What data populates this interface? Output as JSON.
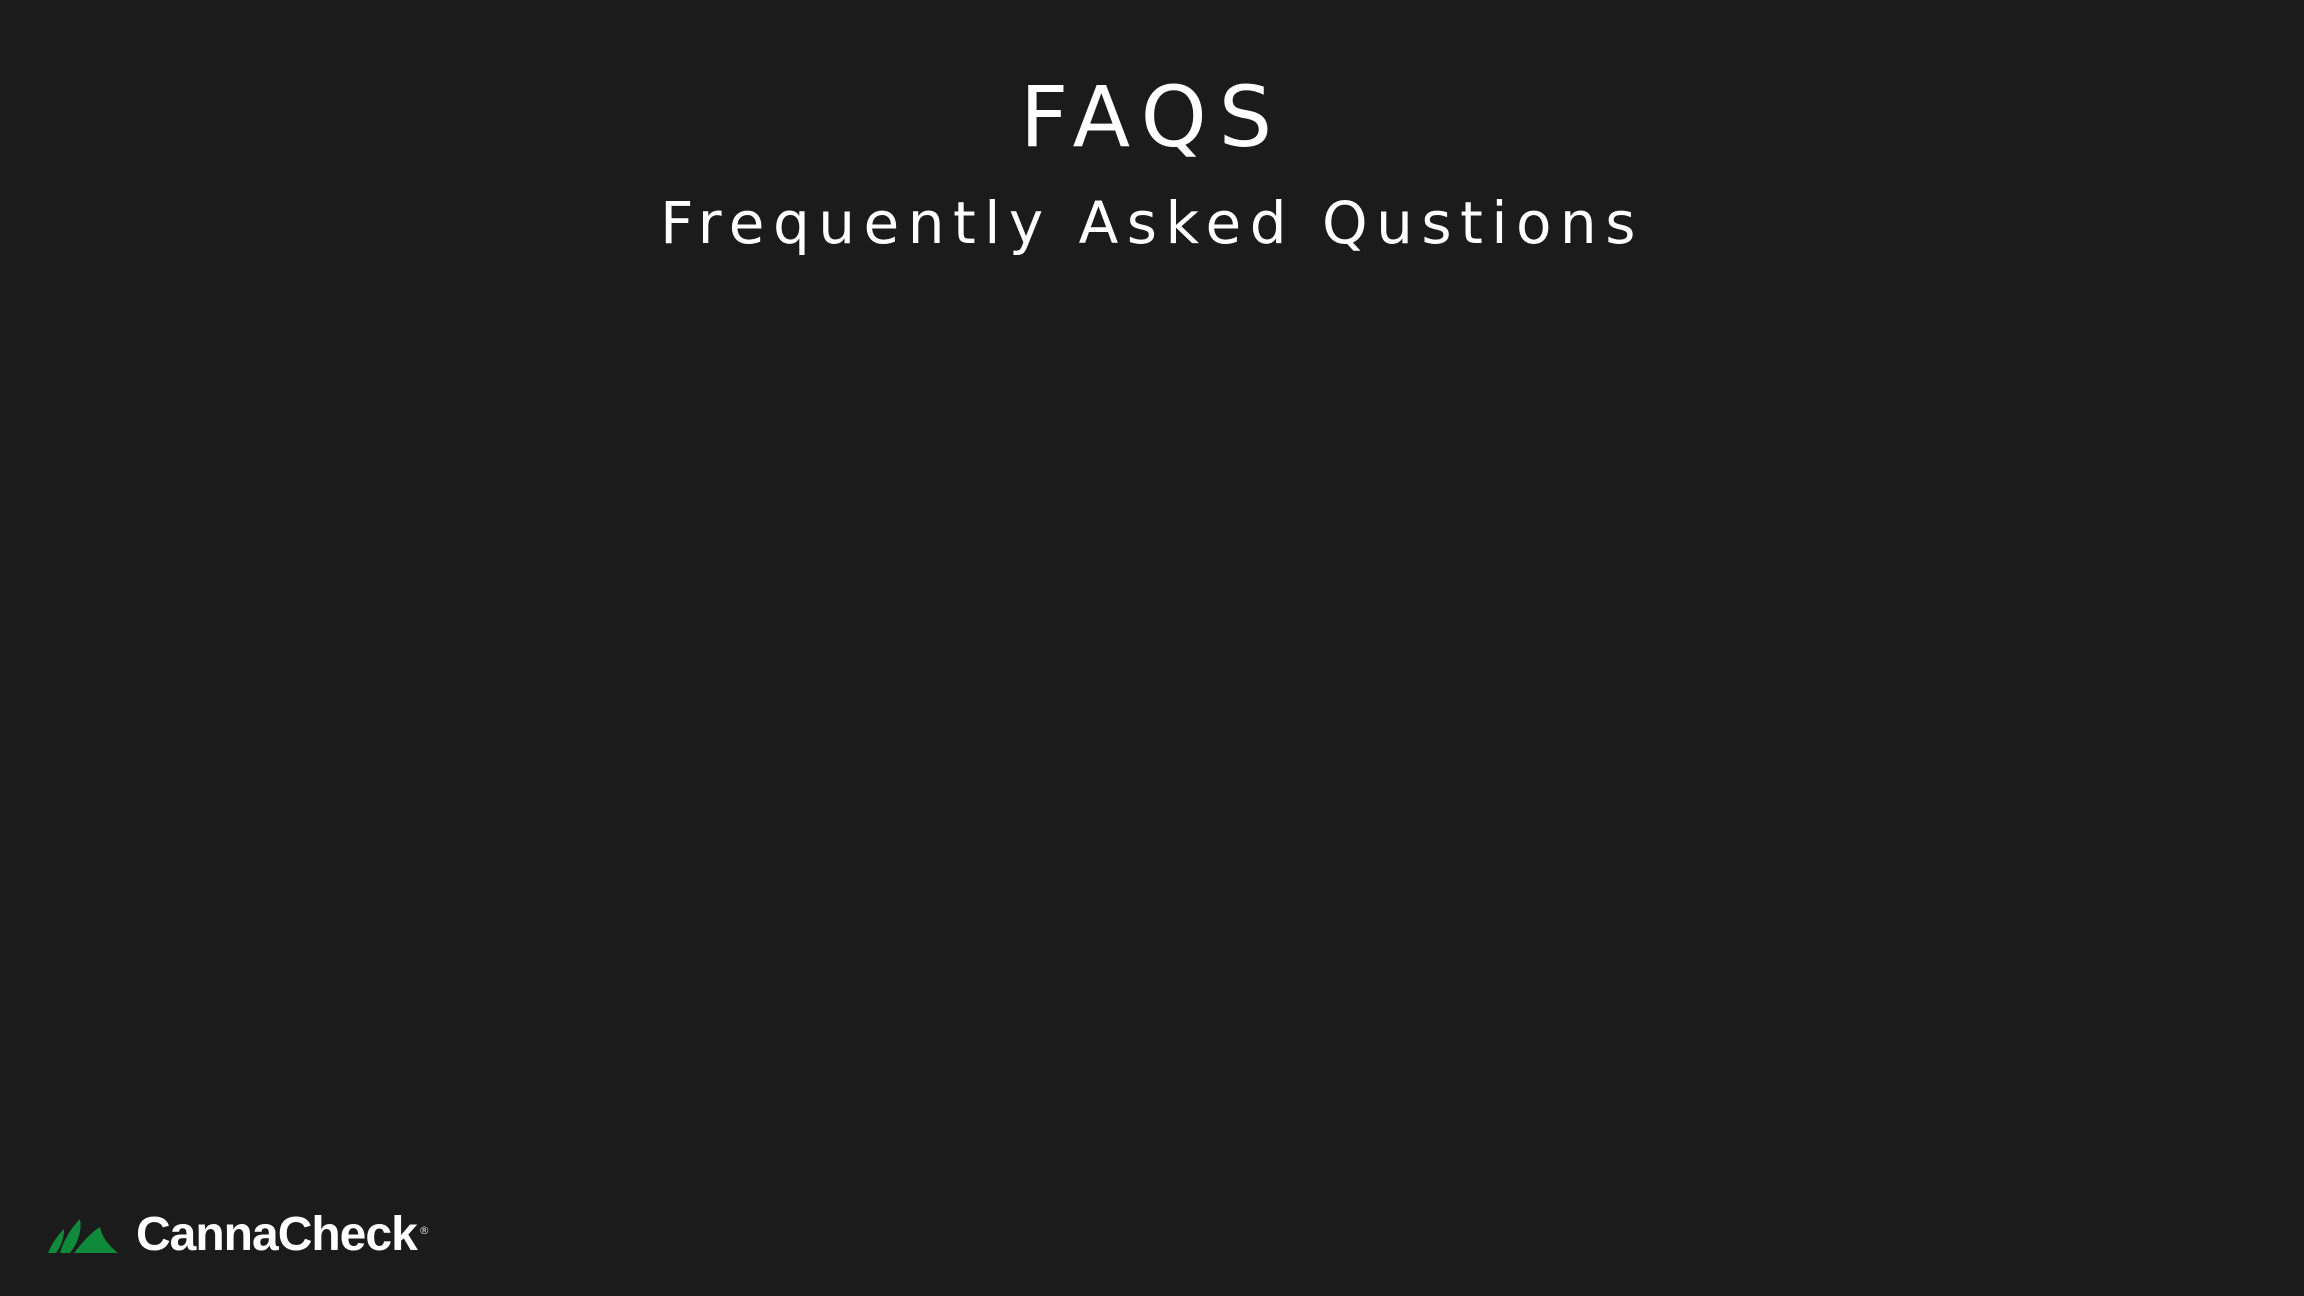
{
  "header": {
    "title": "FAQS",
    "subtitle": "Frequently Asked Qustions"
  },
  "brand": {
    "name": "CannaCheck",
    "registered_mark": "®",
    "mark_icon": "cannacheck-leaf-icon",
    "accent_color": "#0f8a3b"
  },
  "theme": {
    "background": "#1b1b1b",
    "text": "#ffffff"
  }
}
